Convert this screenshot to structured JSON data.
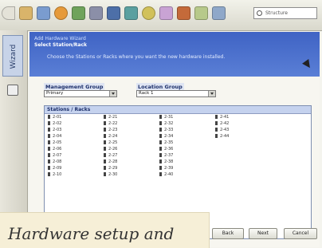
{
  "toolbar": {
    "icons": [
      "back-icon",
      "home-icon",
      "folder-icon",
      "pie-chart-icon",
      "image-icon",
      "network-icon",
      "phone-icon",
      "wand-icon",
      "refresh-icon",
      "flag-icon",
      "building-icon",
      "note-icon",
      "chart-icon"
    ],
    "search_text": "Structure"
  },
  "rail": {
    "tab_label": "Wizard"
  },
  "banner": {
    "crumb": "Add Hardware Wizard",
    "heading": "Select Station/Rack",
    "instruction": "Choose the Stations or Racks where you want the new hardware installed."
  },
  "form": {
    "management_group_label": "Management Group",
    "management_group_value": "Primary",
    "location_group_label": "Location Group",
    "location_group_value": "Rack 1"
  },
  "stations": {
    "header": "Stations / Racks",
    "columns": [
      [
        "2-01",
        "2-02",
        "2-03",
        "2-04",
        "2-05",
        "2-06",
        "2-07",
        "2-08",
        "2-09",
        "2-10"
      ],
      [
        "2-21",
        "2-22",
        "2-23",
        "2-24",
        "2-25",
        "2-26",
        "2-27",
        "2-28",
        "2-29",
        "2-30"
      ],
      [
        "2-31",
        "2-32",
        "2-33",
        "2-34",
        "2-35",
        "2-36",
        "2-37",
        "2-38",
        "2-39",
        "2-40"
      ],
      [
        "2-41",
        "2-42",
        "2-43",
        "2-44"
      ]
    ]
  },
  "buttons": {
    "back": "Back",
    "next": "Next",
    "cancel": "Cancel"
  },
  "caption": "Hardware setup and"
}
